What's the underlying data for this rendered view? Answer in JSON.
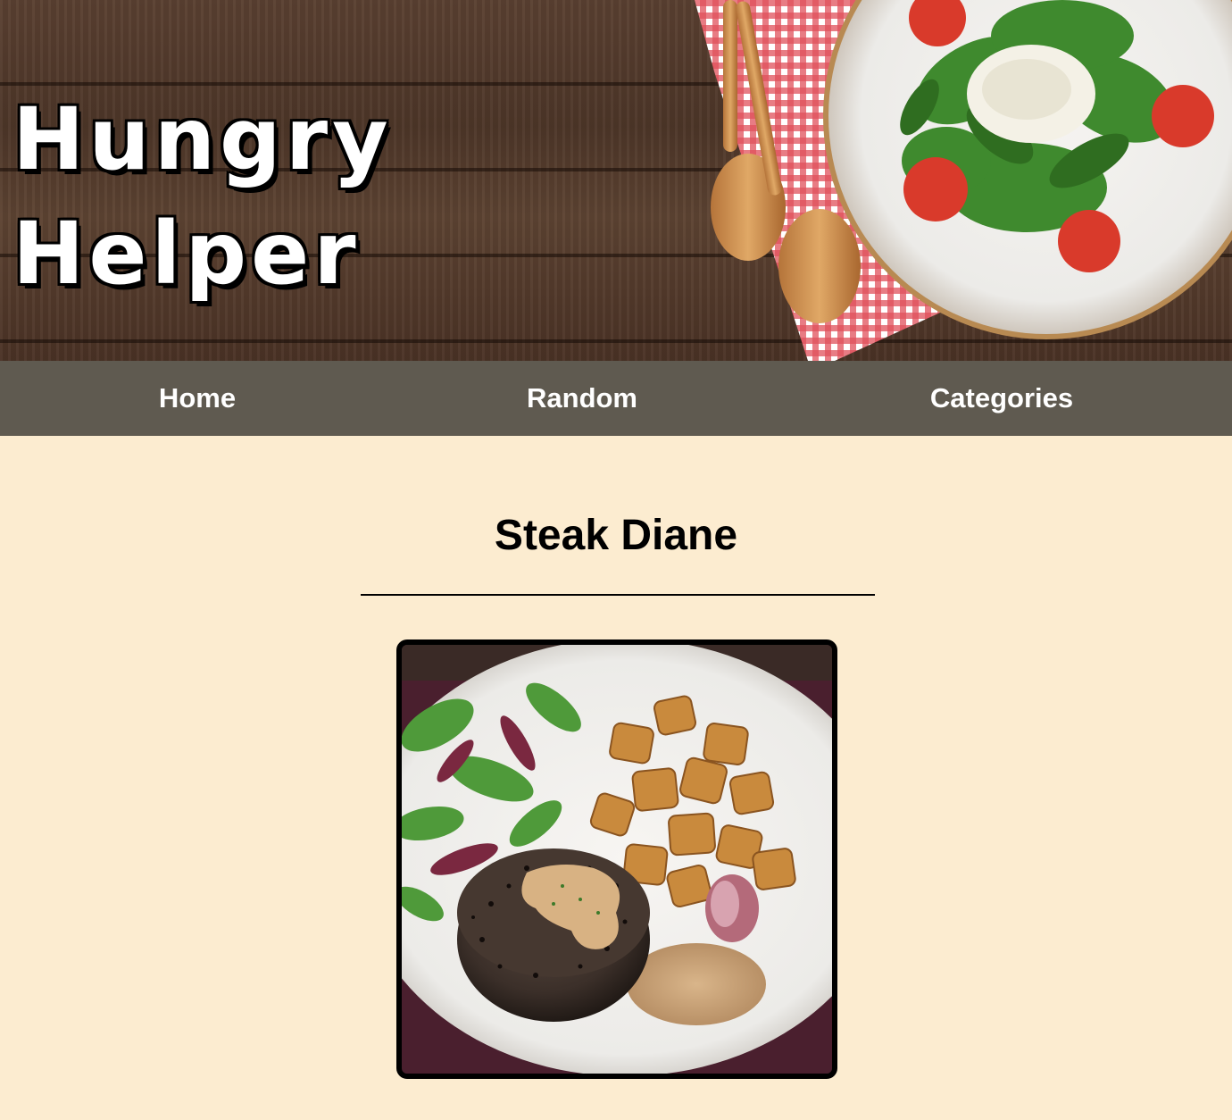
{
  "site": {
    "logo_line1": "Hungry",
    "logo_line2": "Helper"
  },
  "nav": {
    "items": [
      {
        "label": "Home"
      },
      {
        "label": "Random"
      },
      {
        "label": "Categories"
      }
    ]
  },
  "recipe": {
    "title": "Steak Diane"
  },
  "colors": {
    "background": "#fcecd0",
    "nav": "#5f5a50",
    "nav_text": "#ffffff"
  }
}
